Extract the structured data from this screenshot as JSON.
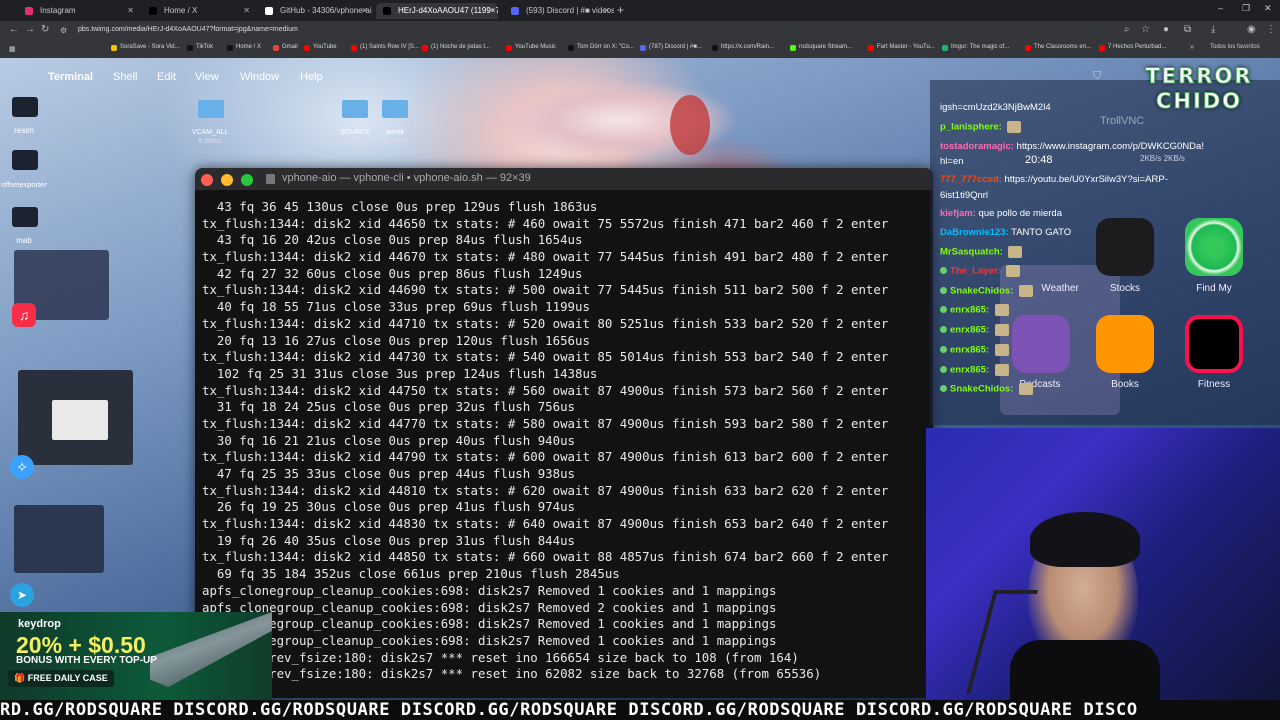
{
  "browser": {
    "tabs": [
      {
        "label": "Instagram",
        "color": "#e1306c"
      },
      {
        "label": "Home / X",
        "color": "#000000"
      },
      {
        "label": "GitHub - 34306/vphone-aio: 1",
        "color": "#ffffff"
      },
      {
        "label": "HErJ-d4XoAAOU47 (1199×780)",
        "color": "#000000"
      },
      {
        "label": "(593) Discord | #■ videos-crea",
        "color": "#5865f2"
      }
    ],
    "new_tab": "+",
    "url": "pbs.twimg.com/media/HErJ-d4XoAAOU47?format=jpg&name=medium",
    "bookmarks": [
      {
        "label": "SoraSave - Sora Vid...",
        "color": "#f5c400"
      },
      {
        "label": "TikTok",
        "color": "#111111"
      },
      {
        "label": "Home / X",
        "color": "#111111"
      },
      {
        "label": "Gmail",
        "color": "#ea4335"
      },
      {
        "label": "YouTube",
        "color": "#ff0000"
      },
      {
        "label": "(1) Saints Row IV [S...",
        "color": "#ff0000"
      },
      {
        "label": "(1) Noche de jodas t...",
        "color": "#ff0000"
      },
      {
        "label": "YouTube Music",
        "color": "#ff0000"
      },
      {
        "label": "Tom Dörr on X: \"Co...",
        "color": "#111111"
      },
      {
        "label": "(787) Discord | #■...",
        "color": "#5865f2"
      },
      {
        "label": "https://x.com/Rain...",
        "color": "#111111"
      },
      {
        "label": "rodsquare Stream...",
        "color": "#53fc18"
      },
      {
        "label": "Fart Master - YouTu...",
        "color": "#ff0000"
      },
      {
        "label": "Imgur: The magic of...",
        "color": "#1bb76e"
      },
      {
        "label": "The Classrooms en...",
        "color": "#ff0000"
      },
      {
        "label": "7 Hechos Perturbad...",
        "color": "#ff0000"
      }
    ],
    "all_bookmarks": "Todos los favoritos"
  },
  "mac_menu": {
    "app": "Terminal",
    "items": [
      "Shell",
      "Edit",
      "View",
      "Window",
      "Help"
    ]
  },
  "desktop": {
    "icons": [
      "resim",
      "offsetexporter",
      "mab"
    ],
    "folders": [
      {
        "name": "VCAM_ALL",
        "count": "6 items"
      },
      {
        "name": "SOURCE",
        "count": "31 items"
      },
      {
        "name": "tweak",
        "count": "31 items"
      }
    ]
  },
  "terminal": {
    "title": "vphone-aio — vphone-cli • vphone-aio.sh — 92×39",
    "lines": [
      "  43 fq 36 45 130us close 0us prep 129us flush 1863us",
      "tx_flush:1344: disk2 xid 44650 tx stats: # 460 owait 75 5572us finish 471 bar2 460 f 2 enter",
      "  43 fq 16 20 42us close 0us prep 84us flush 1654us",
      "tx_flush:1344: disk2 xid 44670 tx stats: # 480 owait 77 5445us finish 491 bar2 480 f 2 enter",
      "  42 fq 27 32 60us close 0us prep 86us flush 1249us",
      "tx_flush:1344: disk2 xid 44690 tx stats: # 500 owait 77 5445us finish 511 bar2 500 f 2 enter",
      "  40 fq 18 55 71us close 33us prep 69us flush 1199us",
      "tx_flush:1344: disk2 xid 44710 tx stats: # 520 owait 80 5251us finish 533 bar2 520 f 2 enter",
      "  20 fq 13 16 27us close 0us prep 120us flush 1656us",
      "tx_flush:1344: disk2 xid 44730 tx stats: # 540 owait 85 5014us finish 553 bar2 540 f 2 enter",
      "  102 fq 25 31 31us close 3us prep 124us flush 1438us",
      "tx_flush:1344: disk2 xid 44750 tx stats: # 560 owait 87 4900us finish 573 bar2 560 f 2 enter",
      "  31 fq 18 24 25us close 0us prep 32us flush 756us",
      "tx_flush:1344: disk2 xid 44770 tx stats: # 580 owait 87 4900us finish 593 bar2 580 f 2 enter",
      "  30 fq 16 21 21us close 0us prep 40us flush 940us",
      "tx_flush:1344: disk2 xid 44790 tx stats: # 600 owait 87 4900us finish 613 bar2 600 f 2 enter",
      "  47 fq 25 35 33us close 0us prep 44us flush 938us",
      "tx_flush:1344: disk2 xid 44810 tx stats: # 620 owait 87 4900us finish 633 bar2 620 f 2 enter",
      "  26 fq 19 25 30us close 0us prep 41us flush 974us",
      "tx_flush:1344: disk2 xid 44830 tx stats: # 640 owait 87 4900us finish 653 bar2 640 f 2 enter",
      "  19 fq 26 40 35us close 0us prep 31us flush 844us",
      "tx_flush:1344: disk2 xid 44850 tx stats: # 660 owait 88 4857us finish 674 bar2 660 f 2 enter",
      "  69 fq 35 184 352us close 661us prep 210us flush 2845us",
      "apfs_clonegroup_cleanup_cookies:698: disk2s7 Removed 1 cookies and 1 mappings",
      "apfs_clonegroup_cleanup_cookies:698: disk2s7 Removed 2 cookies and 1 mappings",
      "apfs_clonegroup_cleanup_cookies:698: disk2s7 Removed 1 cookies and 1 mappings",
      "apfs_clonegroup_cleanup_cookies:698: disk2s7 Removed 1 cookies and 1 mappings",
      "apfs_to_prev_fsize:180: disk2s7 *** reset ino 166654 size back to 108 (from 164)",
      "apfs_to_prev_fsize:180: disk2s7 *** reset ino 62082 size back to 32768 (from 65536)"
    ]
  },
  "chat": {
    "messages": [
      {
        "user": "",
        "text": "igsh=cmUzd2k3NjBwM2l4",
        "color": "#ffffff"
      },
      {
        "user": "p_lanisphere:",
        "text": "",
        "color": "#7fff00"
      },
      {
        "user": "tostadoramagic:",
        "text": "https://www.instagram.com/p/DWKCG0NDa!",
        "color": "#ff69b4"
      },
      {
        "user": "",
        "text": "hl=en",
        "color": "#ffffff"
      },
      {
        "user": "777_777ccxd:",
        "text": "https://youtu.be/U0YxrSilw3Y?si=ARP-",
        "color": "#ff4500"
      },
      {
        "user": "",
        "text": "6ist1ti9Qnrl",
        "color": "#ffffff"
      },
      {
        "user": "kiefjam:",
        "text": "que pollo de mierda",
        "color": "#ff69b4"
      },
      {
        "user": "DaBrownie123:",
        "text": "TANTO GATO",
        "color": "#00bfff"
      },
      {
        "user": "MrSasquatch:",
        "text": "",
        "color": "#7fff00"
      },
      {
        "user": "The_Layer:",
        "text": "",
        "color": "#ff3030"
      },
      {
        "user": "SnakeChidos:",
        "text": "",
        "color": "#7fff00"
      },
      {
        "user": "enrx865:",
        "text": "",
        "color": "#7fff00"
      },
      {
        "user": "enrx865:",
        "text": "",
        "color": "#7fff00"
      },
      {
        "user": "enrx865:",
        "text": "",
        "color": "#7fff00"
      },
      {
        "user": "enrx865:",
        "text": "",
        "color": "#7fff00"
      },
      {
        "user": "SnakeChidos:",
        "text": "",
        "color": "#7fff00"
      }
    ],
    "clock": "20:48",
    "clock_sub": "2KB/s  2KB/s",
    "vnc_label": "TrollVNC"
  },
  "phone_apps": [
    {
      "label": "Weather"
    },
    {
      "label": "Stocks"
    },
    {
      "label": "Find My"
    },
    {
      "label": "Podcasts"
    },
    {
      "label": "Books"
    },
    {
      "label": "Fitness"
    }
  ],
  "logo": {
    "line1": "TERROR",
    "line2": "CHIDO"
  },
  "ad": {
    "brand": "keydrop",
    "headline": "20% + $0.50",
    "sub": "BONUS WITH EVERY TOP-UP",
    "cta": "FREE DAILY CASE"
  },
  "ticker": "RD.GG/RODSQUARE DISCORD.GG/RODSQUARE DISCORD.GG/RODSQUARE DISCORD.GG/RODSQUARE DISCORD.GG/RODSQUARE DISCO"
}
